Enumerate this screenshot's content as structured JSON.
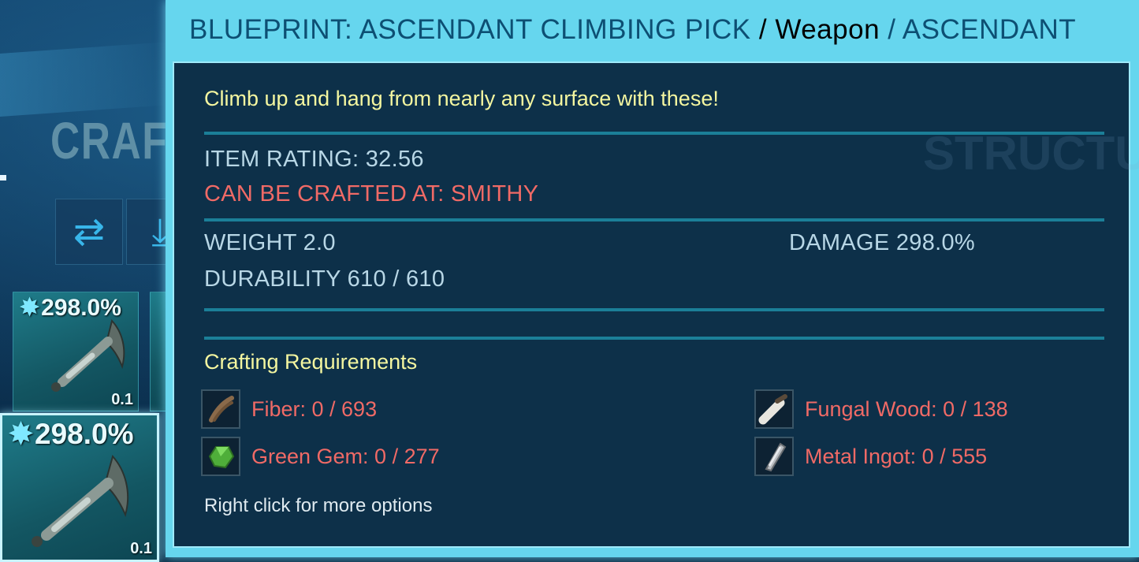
{
  "background": {
    "section_title": "CRAFT",
    "tool_buttons": [
      {
        "icon": "swap-arrows-icon"
      },
      {
        "icon": "drop-down-arrow-icon"
      }
    ],
    "inventory_slots": [
      {
        "bonus": "298.0%",
        "weight": "0.1",
        "icon": "climbing-pick-icon",
        "selected": false
      },
      {
        "bonus": "298.0%",
        "weight": "0.1",
        "icon": "climbing-pick-icon",
        "selected": true
      }
    ],
    "colors": {
      "accent": "#38b6ea",
      "slot": "#1f7c8a"
    }
  },
  "tooltip": {
    "header": {
      "name": "BLUEPRINT: ASCENDANT CLIMBING PICK",
      "separator1": " / ",
      "category": "Weapon",
      "separator2": " / ",
      "quality": "ASCENDANT"
    },
    "description": "Climb up and hang from nearly any surface with these!",
    "item_rating": "ITEM RATING: 32.56",
    "crafted_at": "CAN BE CRAFTED AT: SMITHY",
    "weight": "WEIGHT 2.0",
    "damage": "DAMAGE 298.0%",
    "durability": "DURABILITY 610 / 610",
    "requirements_title": "Crafting Requirements",
    "requirements": [
      {
        "label": "Fiber: 0 / 693",
        "icon": "fiber-icon"
      },
      {
        "label": "Fungal Wood: 0 / 138",
        "icon": "fungal-wood-icon"
      },
      {
        "label": "Green Gem: 0 / 277",
        "icon": "green-gem-icon"
      },
      {
        "label": "Metal Ingot: 0 / 555",
        "icon": "metal-ingot-icon"
      }
    ],
    "hint": "Right click for more options",
    "colors": {
      "header_bg": "#66d6ee",
      "body_bg": "#06233c",
      "desc": "#f4f6a0",
      "stat": "#b8d7e6",
      "warning": "#f06a66"
    }
  }
}
